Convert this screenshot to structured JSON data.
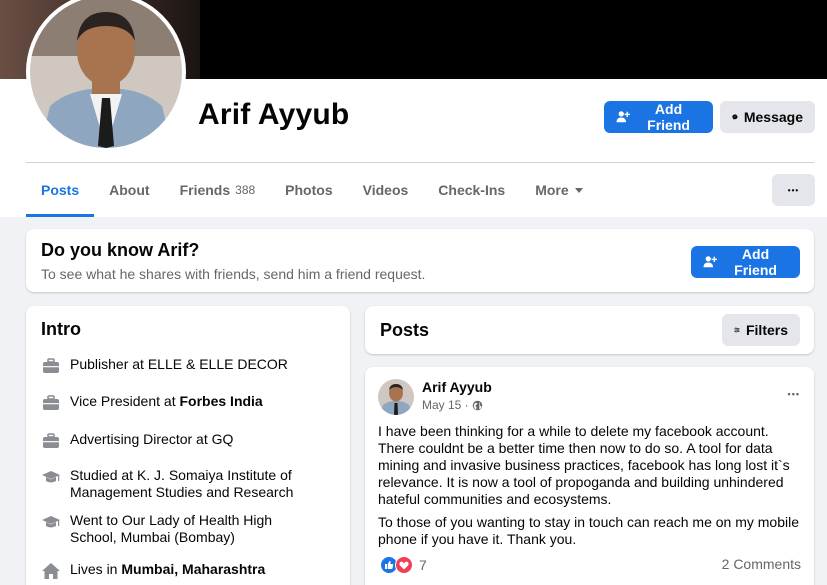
{
  "profile": {
    "name": "Arif Ayyub",
    "add_friend_label": "Add Friend",
    "message_label": "Message",
    "more_dots": "•••"
  },
  "tabs": [
    {
      "label": "Posts",
      "active": true
    },
    {
      "label": "About"
    },
    {
      "label": "Friends",
      "count": "388"
    },
    {
      "label": "Photos"
    },
    {
      "label": "Videos"
    },
    {
      "label": "Check-Ins"
    },
    {
      "label": "More"
    }
  ],
  "know": {
    "title": "Do you know Arif?",
    "subtitle": "To see what he shares with friends, send him a friend request.",
    "add_friend_label": "Add Friend"
  },
  "intro": {
    "title": "Intro",
    "items": [
      {
        "icon": "briefcase-icon",
        "prefix": "Publisher at ",
        "strong": "ELLE & ELLE DECOR",
        "strong_bold": false
      },
      {
        "icon": "briefcase-icon",
        "prefix": "Vice President at ",
        "strong": "Forbes India",
        "strong_bold": true
      },
      {
        "icon": "briefcase-icon",
        "prefix": "Advertising Director at ",
        "strong": "GQ",
        "strong_bold": false
      },
      {
        "icon": "graduation-cap-icon",
        "prefix": "Studied at K. J. Somaiya Institute of Management Studies and Research",
        "strong": "",
        "strong_bold": false
      },
      {
        "icon": "graduation-cap-icon",
        "prefix": "Went to Our Lady of Health High School, Mumbai (Bombay)",
        "strong": "",
        "strong_bold": false
      },
      {
        "icon": "home-icon",
        "prefix": "Lives in ",
        "strong": "Mumbai, Maharashtra",
        "strong_bold": true
      }
    ]
  },
  "posts_header": {
    "title": "Posts",
    "filters_label": "Filters"
  },
  "post": {
    "author": "Arif Ayyub",
    "date": "May 15 ·",
    "more_dots": "•••",
    "paragraph1": "I have been thinking for a while to delete my facebook account. There couldnt be a better time then now to do so. A tool for data mining and invasive business practices, facebook has long lost it`s relevance. It is now a tool of propoganda and building unhindered hateful communities and ecosystems.",
    "paragraph2": "To those of you wanting to stay in touch can reach me on my mobile phone if you have it. Thank you.",
    "reaction_count": "7",
    "comments": "2 Comments"
  },
  "colors": {
    "accent": "#1b74e4",
    "background": "#f0f2f5",
    "secondary_text": "#65676b"
  }
}
